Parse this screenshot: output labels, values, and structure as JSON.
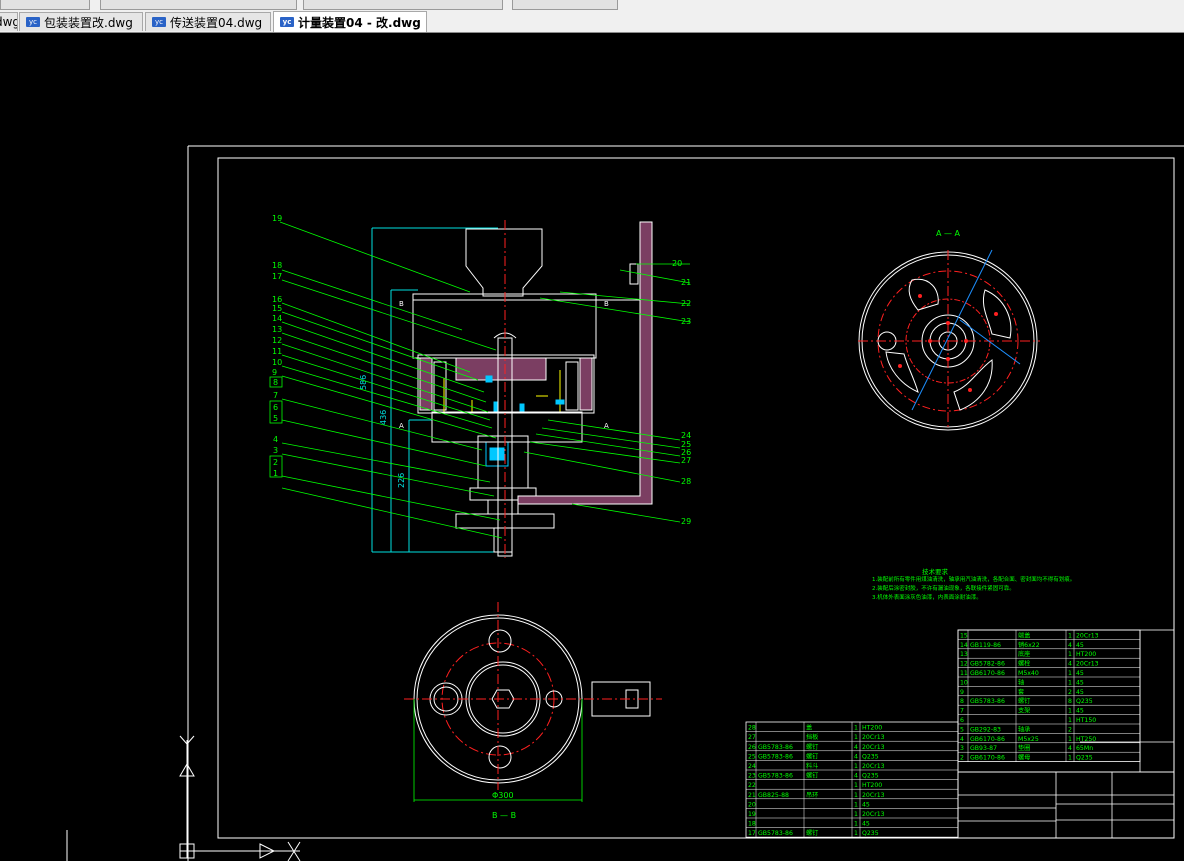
{
  "tabs": [
    {
      "label": "dwg",
      "active": false
    },
    {
      "label": "包装装置改.dwg",
      "active": false
    },
    {
      "label": "传送装置04.dwg",
      "active": false
    },
    {
      "label": "计量装置04 - 改.dwg",
      "active": true
    }
  ],
  "drawing": {
    "section_aa": "A — A",
    "section_bb": "B — B",
    "dim_phi300": "Φ300",
    "dim_586": "586",
    "dim_436": "436",
    "dim_226": "226",
    "section_marks": [
      "B",
      "B",
      "A",
      "A"
    ],
    "left_callouts": [
      "19",
      "18",
      "17",
      "16",
      "15",
      "14",
      "13",
      "12",
      "11",
      "10",
      "9",
      "8",
      "7",
      "6",
      "5",
      "4",
      "3",
      "2",
      "1"
    ],
    "right_callouts": [
      "20",
      "21",
      "22",
      "23",
      "24",
      "25",
      "26",
      "27",
      "28",
      "29"
    ],
    "tech_title": "技术要求",
    "tech_notes": [
      "1.装配前所有零件用煤油清洗，轴承用汽油清洗，各配合面、密封面均不得有划痕。",
      "2.装配后涂密封胶，不许有漏油现象，各联接件紧固可靠。",
      "3.机体外表面涂灰色油漆，内表面涂耐油漆。"
    ],
    "bom_upper": [
      [
        "15",
        "",
        "端盖",
        "1",
        "20Cr13"
      ],
      [
        "14",
        "GB119-86",
        "销6x22",
        "4",
        "45"
      ],
      [
        "13",
        "",
        "底座",
        "1",
        "HT200"
      ],
      [
        "12",
        "GB5782-86",
        "螺栓",
        "4",
        "20Cr13"
      ],
      [
        "11",
        "GB6170-86",
        "M5x40",
        "1",
        "45"
      ],
      [
        "10",
        "",
        "轴",
        "1",
        "45"
      ],
      [
        "9",
        "",
        "套",
        "2",
        "45"
      ],
      [
        "8",
        "GB5783-86",
        "螺钉",
        "8",
        "Q235"
      ],
      [
        "7",
        "",
        "支架",
        "1",
        "45"
      ],
      [
        "6",
        "",
        "",
        "1",
        "HT150"
      ],
      [
        "5",
        "GB292-83",
        "轴承",
        "2",
        ""
      ],
      [
        "4",
        "GB6170-86",
        "M5x25",
        "1",
        "HT250"
      ],
      [
        "3",
        "GB93-87",
        "垫圈",
        "4",
        "65Mn"
      ],
      [
        "2",
        "GB6170-86",
        "螺母",
        "1",
        "Q235"
      ]
    ],
    "bom_lower": [
      [
        "28",
        "",
        "盖",
        "1",
        "HT200"
      ],
      [
        "27",
        "",
        "挡板",
        "1",
        "20Cr13"
      ],
      [
        "26",
        "GB5783-86",
        "螺钉",
        "4",
        "20Cr13"
      ],
      [
        "25",
        "GB5783-86",
        "螺钉",
        "4",
        "Q235"
      ],
      [
        "24",
        "",
        "料斗",
        "1",
        "20Cr13"
      ],
      [
        "23",
        "GB5783-86",
        "螺钉",
        "4",
        "Q235"
      ],
      [
        "22",
        "",
        "",
        "1",
        "HT200"
      ],
      [
        "21",
        "GB825-88",
        "吊环",
        "1",
        "20Cr13"
      ],
      [
        "20",
        "",
        "",
        "1",
        "45"
      ],
      [
        "19",
        "",
        "",
        "1",
        "20Cr13"
      ],
      [
        "18",
        "",
        "",
        "1",
        "45"
      ],
      [
        "17",
        "GB5783-86",
        "螺钉",
        "1",
        "Q235"
      ]
    ]
  },
  "colors": {
    "background": "#000000",
    "outline": "#ffffff",
    "callout": "#00ff00",
    "centerline": "#ff2020",
    "dimension": "#00ffff",
    "frame": "#a040c0",
    "part_fill": "#7b3e62",
    "hidden_line": "#ffff00",
    "grip": "#1e90ff"
  }
}
